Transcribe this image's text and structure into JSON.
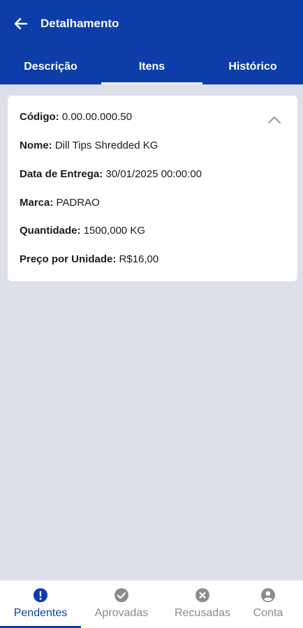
{
  "header": {
    "title": "Detalhamento",
    "back_icon": "arrow-left-icon"
  },
  "tabs": [
    {
      "label": "Descrição",
      "active": false
    },
    {
      "label": "Itens",
      "active": true
    },
    {
      "label": "Histórico",
      "active": false
    }
  ],
  "item": {
    "codigo": {
      "label": "Código:",
      "value": "0.00.00.000.50"
    },
    "nome": {
      "label": "Nome:",
      "value": "Dill Tips Shredded KG"
    },
    "data_entrega": {
      "label": "Data de Entrega:",
      "value": "30/01/2025 00:00:00"
    },
    "marca": {
      "label": "Marca:",
      "value": "PADRAO"
    },
    "quantidade": {
      "label": "Quantidade:",
      "value": "1500,000 KG"
    },
    "preco": {
      "label": "Preço por Unidade:",
      "value": "R$16,00"
    },
    "collapse_icon": "chevron-up-icon"
  },
  "bottom_nav": [
    {
      "label": "Pendentes",
      "icon": "alert-circle-icon",
      "active": true
    },
    {
      "label": "Aprovadas",
      "icon": "check-circle-icon",
      "active": false
    },
    {
      "label": "Recusadas",
      "icon": "x-circle-icon",
      "active": false
    },
    {
      "label": "Conta",
      "icon": "account-circle-icon",
      "active": false
    }
  ],
  "colors": {
    "primary": "#0d3da8",
    "background": "#dddfe9",
    "inactive": "#8c8c8c"
  }
}
